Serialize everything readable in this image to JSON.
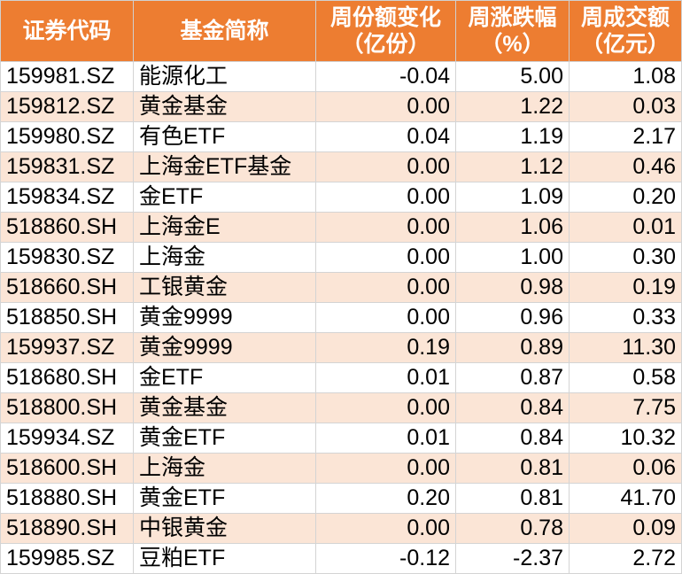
{
  "table": {
    "headers": [
      [
        "证券代码"
      ],
      [
        "基金简称"
      ],
      [
        "周份额变化",
        "（亿份）"
      ],
      [
        "周涨跌幅",
        "（%）"
      ],
      [
        "周成交额",
        "（亿元）"
      ]
    ],
    "rows": [
      [
        "159981.SZ",
        "能源化工",
        "-0.04",
        "5.00",
        "1.08"
      ],
      [
        "159812.SZ",
        "黄金基金",
        "0.00",
        "1.22",
        "0.03"
      ],
      [
        "159980.SZ",
        "有色ETF",
        "0.04",
        "1.19",
        "2.17"
      ],
      [
        "159831.SZ",
        "上海金ETF基金",
        "0.00",
        "1.12",
        "0.46"
      ],
      [
        "159834.SZ",
        "金ETF",
        "0.00",
        "1.09",
        "0.20"
      ],
      [
        "518860.SH",
        "上海金E",
        "0.00",
        "1.06",
        "0.01"
      ],
      [
        "159830.SZ",
        "上海金",
        "0.00",
        "1.00",
        "0.30"
      ],
      [
        "518660.SH",
        "工银黄金",
        "0.00",
        "0.98",
        "0.19"
      ],
      [
        "518850.SH",
        "黄金9999",
        "0.00",
        "0.96",
        "0.33"
      ],
      [
        "159937.SZ",
        "黄金9999",
        "0.19",
        "0.89",
        "11.30"
      ],
      [
        "518680.SH",
        "金ETF",
        "0.01",
        "0.87",
        "0.58"
      ],
      [
        "518800.SH",
        "黄金基金",
        "0.00",
        "0.84",
        "7.75"
      ],
      [
        "159934.SZ",
        "黄金ETF",
        "0.01",
        "0.84",
        "10.32"
      ],
      [
        "518600.SH",
        "上海金",
        "0.00",
        "0.81",
        "0.06"
      ],
      [
        "518880.SH",
        "黄金ETF",
        "0.20",
        "0.81",
        "41.70"
      ],
      [
        "518890.SH",
        "中银黄金",
        "0.00",
        "0.78",
        "0.09"
      ],
      [
        "159985.SZ",
        "豆粕ETF",
        "-0.12",
        "-2.37",
        "2.72"
      ]
    ]
  },
  "colors": {
    "header_bg": "#ED7D31",
    "header_text": "#FFFFFF",
    "row_alt_bg": "#FBE5D6",
    "row_bg": "#FFFFFF"
  }
}
